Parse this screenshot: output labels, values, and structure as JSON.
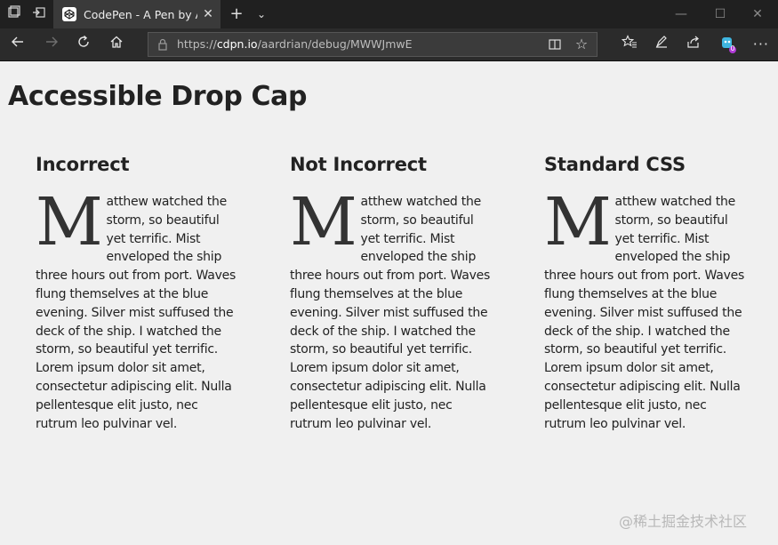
{
  "browser": {
    "tab_title": "CodePen - A Pen by Adr",
    "url_prefix": "https://",
    "url_host": "cdpn.io",
    "url_path": "/aardrian/debug/MWWJmwE",
    "ext_badge": "0"
  },
  "page": {
    "heading": "Accessible Drop Cap",
    "columns": [
      {
        "heading": "Incorrect",
        "dropcap": "M",
        "text": "atthew watched the storm, so beautiful yet terrific. Mist enveloped the ship three hours out from port. Waves flung themselves at the blue evening. Silver mist suffused the deck of the ship. I watched the storm, so beautiful yet terrific. Lorem ipsum dolor sit amet, consectetur adipiscing elit. Nulla pellentesque elit justo, nec rutrum leo pulvinar vel."
      },
      {
        "heading": "Not Incorrect",
        "dropcap": "M",
        "text": "atthew watched the storm, so beautiful yet terrific. Mist enveloped the ship three hours out from port. Waves flung themselves at the blue evening. Silver mist suffused the deck of the ship. I watched the storm, so beautiful yet terrific. Lorem ipsum dolor sit amet, consectetur adipiscing elit. Nulla pellentesque elit justo, nec rutrum leo pulvinar vel."
      },
      {
        "heading": "Standard CSS",
        "dropcap": "M",
        "text": "atthew watched the storm, so beautiful yet terrific. Mist enveloped the ship three hours out from port. Waves flung themselves at the blue evening. Silver mist suffused the deck of the ship. I watched the storm, so beautiful yet terrific. Lorem ipsum dolor sit amet, consectetur adipiscing elit. Nulla pellentesque elit justo, nec rutrum leo pulvinar vel."
      }
    ],
    "watermark": "@稀土掘金技术社区"
  },
  "icons": {
    "tabs_aside": "tabs-aside-icon",
    "set_aside": "set-tabs-aside-icon",
    "codepen": "codepen-icon",
    "close": "close-icon",
    "new_tab": "plus-icon",
    "tab_list": "chevron-down-icon",
    "minimize": "minimize-icon",
    "maximize": "maximize-icon",
    "window_close": "window-close-icon",
    "back": "back-arrow-icon",
    "forward": "forward-arrow-icon",
    "refresh": "refresh-icon",
    "home": "home-icon",
    "lock": "lock-icon",
    "reading_view": "reading-view-icon",
    "favorite": "star-icon",
    "favorites_bar": "favorites-icon",
    "notes": "pen-icon",
    "share": "share-icon",
    "extension": "extension-icon",
    "more": "more-icon"
  },
  "colors": {
    "page_background": "#f0f0f0",
    "text": "#222222",
    "chrome_dark": "#202020"
  }
}
